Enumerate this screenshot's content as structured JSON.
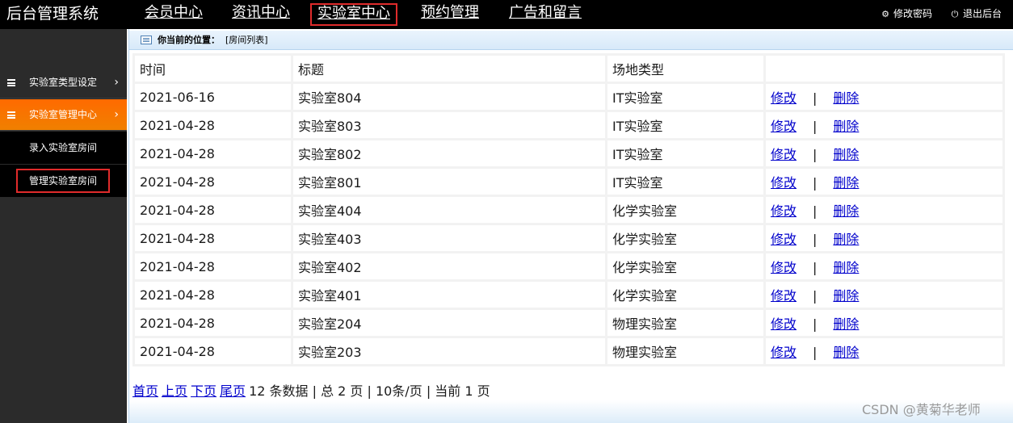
{
  "app_title": "后台管理系统",
  "nav": [
    {
      "label": "会员中心"
    },
    {
      "label": "资讯中心"
    },
    {
      "label": "实验室中心"
    },
    {
      "label": "预约管理"
    },
    {
      "label": "广告和留言"
    }
  ],
  "top_actions": {
    "change_password": "修改密码",
    "logout": "退出后台"
  },
  "sidebar": {
    "items": [
      {
        "label": "实验室类型设定",
        "chevron": "›"
      },
      {
        "label": "实验室管理中心",
        "chevron": "›"
      },
      {
        "label": "录入实验室房间"
      },
      {
        "label": "管理实验室房间"
      }
    ]
  },
  "breadcrumb": {
    "label": "你当前的位置：",
    "value": "[房间列表]"
  },
  "table": {
    "headers": [
      "时间",
      "标题",
      "场地类型",
      ""
    ],
    "edit_label": "修改",
    "separator": "|",
    "delete_label": "删除",
    "rows": [
      {
        "time": "2021-06-16",
        "title": "实验室804",
        "type": "IT实验室"
      },
      {
        "time": "2021-04-28",
        "title": "实验室803",
        "type": "IT实验室"
      },
      {
        "time": "2021-04-28",
        "title": "实验室802",
        "type": "IT实验室"
      },
      {
        "time": "2021-04-28",
        "title": "实验室801",
        "type": "IT实验室"
      },
      {
        "time": "2021-04-28",
        "title": "实验室404",
        "type": "化学实验室"
      },
      {
        "time": "2021-04-28",
        "title": "实验室403",
        "type": "化学实验室"
      },
      {
        "time": "2021-04-28",
        "title": "实验室402",
        "type": "化学实验室"
      },
      {
        "time": "2021-04-28",
        "title": "实验室401",
        "type": "化学实验室"
      },
      {
        "time": "2021-04-28",
        "title": "实验室204",
        "type": "物理实验室"
      },
      {
        "time": "2021-04-28",
        "title": "实验室203",
        "type": "物理实验室"
      }
    ]
  },
  "pager": {
    "first": "首页",
    "prev": "上页",
    "next": "下页",
    "last": "尾页",
    "summary": "12 条数据 | 总 2 页 | 10条/页 | 当前 1 页"
  },
  "watermark": "CSDN @黄菊华老师",
  "colors": {
    "topbar": "#000000",
    "sidebar": "#2b2b2b",
    "sidebar_active": "#f08000",
    "highlight_box": "#e02b2b",
    "link": "#0000cc"
  }
}
